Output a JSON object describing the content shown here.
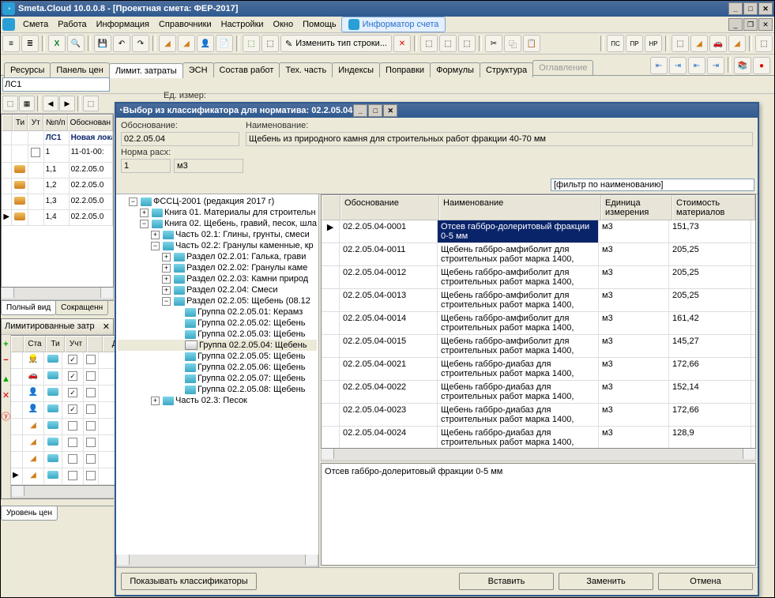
{
  "app": {
    "title": "Smeta.Cloud  10.0.0.8   -  [Проектная смета: ФЕР-2017]"
  },
  "menu": [
    "Смета",
    "Работа",
    "Информация",
    "Справочники",
    "Настройки",
    "Окно",
    "Помощь"
  ],
  "informer": "Информатор счета",
  "toolbar_change": "Изменить тип строки...",
  "tabs": [
    "Ресурсы",
    "Панель цен",
    "Лимит. затраты",
    "ЭСН",
    "Состав работ",
    "Тех. часть",
    "Индексы",
    "Поправки",
    "Формулы",
    "Структура"
  ],
  "tabs_disabled": "Оглавление",
  "active_tab": 2,
  "combo_value": "ЛС1",
  "main_grid": {
    "cols": [
      "Ти",
      "Ут",
      "№п/п",
      "Обоснован"
    ],
    "rows": [
      {
        "mark": "",
        "ico": "",
        "chk": "",
        "np": "ЛС1",
        "ob": "Новая локальн",
        "bold": true,
        "color": "#0a246a"
      },
      {
        "mark": "",
        "ico": "",
        "chk": false,
        "np": "1",
        "ob": "11-01-00:"
      },
      {
        "mark": "",
        "ico": "side",
        "chk": "",
        "np": "1,1",
        "ob": "02.2.05.0"
      },
      {
        "mark": "",
        "ico": "side",
        "chk": "",
        "np": "1,2",
        "ob": "02.2.05.0"
      },
      {
        "mark": "",
        "ico": "side",
        "chk": "",
        "np": "1,3",
        "ob": "02.2.05.0"
      },
      {
        "mark": "▶",
        "ico": "side",
        "chk": "",
        "np": "1,4",
        "ob": "02.2.05.0"
      }
    ]
  },
  "bottom_tabs": [
    "Полный вид",
    "Сокращенн"
  ],
  "lim_panel_title": "Лимитированные затр",
  "lim_cols": [
    "",
    "Ста",
    "Ти",
    "Учт",
    "",
    "До"
  ],
  "lim_rows": 8,
  "level_tab": "Уровень цен",
  "dialog": {
    "title": "Выбор из классификатора для норматива: 02.2.05.04",
    "labels": {
      "ob": "Обоснование:",
      "nm": "Наименование:",
      "norm": "Норма расх:",
      "unit": "Ед. измер:"
    },
    "values": {
      "ob": "02.2.05.04",
      "nm": "Щебень из природного камня для строительных работ фракции 40-70 мм",
      "norm": "1",
      "unit": "м3"
    },
    "filter_placeholder": "[фильтр по наименованию]",
    "tree_root": "ФССЦ-2001 (редакция 2017 г)",
    "tree": [
      {
        "d": 1,
        "exp": "-",
        "ico": "cyan",
        "t": "ФССЦ-2001 (редакция 2017 г)"
      },
      {
        "d": 2,
        "exp": "+",
        "ico": "cyan",
        "t": "Книга 01. Материалы для строительн"
      },
      {
        "d": 2,
        "exp": "-",
        "ico": "cyan",
        "t": "Книга 02. Щебень, гравий, песок, шла"
      },
      {
        "d": 3,
        "exp": "+",
        "ico": "cyan",
        "t": "Часть 02.1: Глины, грунты, смеси"
      },
      {
        "d": 3,
        "exp": "-",
        "ico": "cyan",
        "t": "Часть 02.2: Гранулы каменные, кр"
      },
      {
        "d": 4,
        "exp": "+",
        "ico": "cyan",
        "t": "Раздел 02.2.01: Галька, грави"
      },
      {
        "d": 4,
        "exp": "+",
        "ico": "cyan",
        "t": "Раздел 02.2.02: Гранулы каме"
      },
      {
        "d": 4,
        "exp": "+",
        "ico": "cyan",
        "t": "Раздел 02.2.03: Камни природ"
      },
      {
        "d": 4,
        "exp": "+",
        "ico": "cyan",
        "t": "Раздел 02.2.04: Смеси"
      },
      {
        "d": 4,
        "exp": "-",
        "ico": "cyan",
        "t": "Раздел 02.2.05: Щебень (08.12"
      },
      {
        "d": 5,
        "exp": "",
        "ico": "cyan",
        "t": "Группа 02.2.05.01: Керамз"
      },
      {
        "d": 5,
        "exp": "",
        "ico": "cyan",
        "t": "Группа 02.2.05.02: Щебень"
      },
      {
        "d": 5,
        "exp": "",
        "ico": "cyan",
        "t": "Группа 02.2.05.03: Щебень"
      },
      {
        "d": 5,
        "exp": "",
        "ico": "open",
        "t": "Группа 02.2.05.04: Щебень",
        "sel": true
      },
      {
        "d": 5,
        "exp": "",
        "ico": "cyan",
        "t": "Группа 02.2.05.05: Щебень"
      },
      {
        "d": 5,
        "exp": "",
        "ico": "cyan",
        "t": "Группа 02.2.05.06: Щебень"
      },
      {
        "d": 5,
        "exp": "",
        "ico": "cyan",
        "t": "Группа 02.2.05.07: Щебень"
      },
      {
        "d": 5,
        "exp": "",
        "ico": "cyan",
        "t": "Группа 02.2.05.08: Щебень"
      },
      {
        "d": 3,
        "exp": "+",
        "ico": "cyan",
        "t": "Часть 02.3: Песок"
      }
    ],
    "grid_cols": [
      "Обоснование",
      "Наименование",
      "Единица измерения",
      "Стоимость материалов"
    ],
    "grid_rows": [
      {
        "ob": "02.2.05.04-0001",
        "nm": "Отсев габбро-долеритовый фракции 0-5 мм",
        "u": "м3",
        "c": "151,73",
        "sel": true
      },
      {
        "ob": "02.2.05.04-0011",
        "nm": "Щебень габбро-амфиболит для строительных работ марка 1400,",
        "u": "м3",
        "c": "205,25"
      },
      {
        "ob": "02.2.05.04-0012",
        "nm": "Щебень габбро-амфиболит для строительных работ марка 1400,",
        "u": "м3",
        "c": "205,25"
      },
      {
        "ob": "02.2.05.04-0013",
        "nm": "Щебень габбро-амфиболит для строительных работ марка 1400,",
        "u": "м3",
        "c": "205,25"
      },
      {
        "ob": "02.2.05.04-0014",
        "nm": "Щебень габбро-амфиболит для строительных работ марка 1400,",
        "u": "м3",
        "c": "161,42"
      },
      {
        "ob": "02.2.05.04-0015",
        "nm": "Щебень габбро-амфиболит для строительных работ марка 1400,",
        "u": "м3",
        "c": "145,27"
      },
      {
        "ob": "02.2.05.04-0021",
        "nm": "Щебень габбро-диабаз для строительных работ марка 1400,",
        "u": "м3",
        "c": "172,66"
      },
      {
        "ob": "02.2.05.04-0022",
        "nm": "Щебень габбро-диабаз для строительных работ марка 1400,",
        "u": "м3",
        "c": "152,14"
      },
      {
        "ob": "02.2.05.04-0023",
        "nm": "Щебень габбро-диабаз для строительных работ марка 1400,",
        "u": "м3",
        "c": "172,66"
      },
      {
        "ob": "02.2.05.04-0024",
        "nm": "Щебень габбро-диабаз для строительных работ марка 1400,",
        "u": "м3",
        "c": "128,9"
      }
    ],
    "detail": "Отсев габбро-долеритовый фракции 0-5 мм",
    "buttons": {
      "show": "Показывать классификаторы",
      "insert": "Вставить",
      "replace": "Заменить",
      "cancel": "Отмена"
    }
  }
}
